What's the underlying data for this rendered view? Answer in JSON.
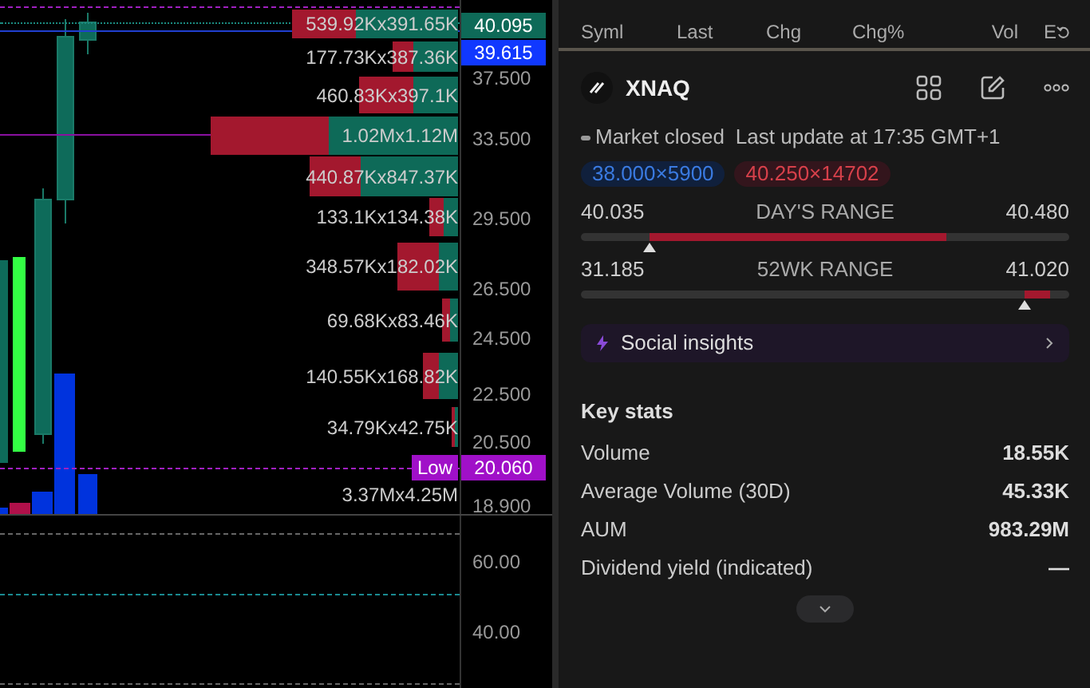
{
  "chart": {
    "price_axis": [
      "37.500",
      "33.500",
      "29.500",
      "26.500",
      "24.500",
      "22.500",
      "20.500",
      "18.900"
    ],
    "price_badges": [
      {
        "kind": "last",
        "text": "40.095"
      },
      {
        "kind": "current",
        "text": "39.615"
      },
      {
        "kind": "low",
        "label": "Low",
        "text": "20.060"
      }
    ],
    "volume_profile": [
      "539.92Kx391.65K",
      "177.73Kx387.36K",
      "460.83Kx397.1K",
      "1.02Mx1.12M",
      "440.87Kx847.37K",
      "133.1Kx134.38K",
      "348.57Kx182.02K",
      "69.68Kx83.46K",
      "140.55Kx168.82K",
      "34.79Kx42.75K",
      "3.37Mx4.25M"
    ],
    "indicator_axis": [
      "60.00",
      "40.00"
    ]
  },
  "watchlist_columns": [
    "Syml",
    "Last",
    "Chg",
    "Chg%",
    "Vol",
    "E"
  ],
  "quote": {
    "symbol": "XNAQ",
    "status": "Market closed",
    "last_update": "Last update at 17:35 GMT+1",
    "bid": "38.000×5900",
    "ask": "40.250×14702",
    "ranges": [
      {
        "low": "40.035",
        "label": "DAY'S RANGE",
        "high": "40.480",
        "marker": {
          "level": 0.14
        }
      },
      {
        "low": "31.185",
        "label": "52WK RANGE",
        "high": "41.020",
        "marker": {
          "level": 0.91
        }
      }
    ],
    "social_insights": "Social insights",
    "key_stats": {
      "title": "Key stats",
      "rows": [
        {
          "label": "Volume",
          "value": "18.55K"
        },
        {
          "label": "Average Volume (30D)",
          "value": "45.33K"
        },
        {
          "label": "AUM",
          "value": "983.29M"
        },
        {
          "label": "Dividend yield (indicated)",
          "value": "—"
        }
      ]
    }
  }
}
